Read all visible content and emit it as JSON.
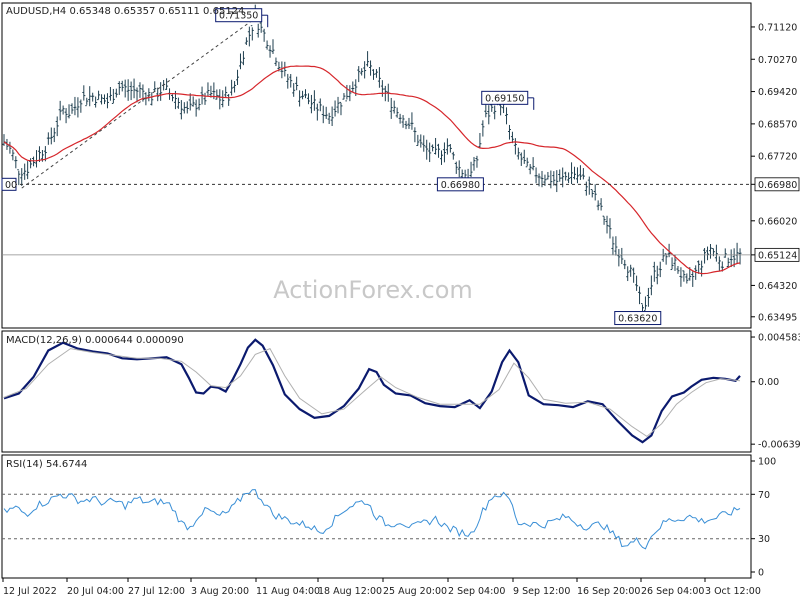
{
  "watermark": "ActionForex.com",
  "colors": {
    "bar": "#1f3f4f",
    "ma": "#d6262b",
    "macd": "#0b1a6e",
    "signal": "#b0b0b0",
    "rsi": "#3a8fd6",
    "frame": "#000000",
    "grid": "#555555"
  },
  "chart_data": [
    {
      "type": "ohlc",
      "panel": "price",
      "title": "AUDUSD,H4  0.65348 0.65357 0.65111 0.65124",
      "ylim": [
        0.632,
        0.7175
      ],
      "y_ticks": [
        "0.71120",
        "0.70270",
        "0.69420",
        "0.68570",
        "0.67720",
        "0.66980",
        "0.66020",
        "0.65124",
        "0.64320",
        "0.63495"
      ],
      "x_ticks": [
        "12 Jul 2022",
        "20 Jul 04:00",
        "27 Jul 12:00",
        "3 Aug 20:00",
        "11 Aug 04:00",
        "18 Aug 12:00",
        "25 Aug 20:00",
        "2 Sep 04:00",
        "9 Sep 12:00",
        "16 Sep 20:00",
        "26 Sep 04:00",
        "3 Oct 12:00"
      ],
      "current_price": "0.65124",
      "horizontal_line": 0.6698,
      "horizontal_line_label": "0.66980",
      "left_edge_label": "00",
      "annotations": [
        {
          "label": "0.71350",
          "value": 0.7135
        },
        {
          "label": "0.69150",
          "value": 0.6915
        },
        {
          "label": "0.66980",
          "value": 0.6698
        },
        {
          "label": "0.63620",
          "value": 0.6362
        }
      ],
      "price_path": [
        [
          0,
          0.681
        ],
        [
          5,
          0.6785
        ],
        [
          10,
          0.6735
        ],
        [
          15,
          0.6735
        ],
        [
          20,
          0.676
        ],
        [
          30,
          0.6805
        ],
        [
          40,
          0.6895
        ],
        [
          45,
          0.6885
        ],
        [
          52,
          0.6925
        ],
        [
          60,
          0.693
        ],
        [
          70,
          0.6915
        ],
        [
          78,
          0.6955
        ],
        [
          85,
          0.6945
        ],
        [
          93,
          0.6945
        ],
        [
          100,
          0.693
        ],
        [
          108,
          0.695
        ],
        [
          116,
          0.6925
        ],
        [
          124,
          0.689
        ],
        [
          132,
          0.6915
        ],
        [
          140,
          0.6935
        ],
        [
          148,
          0.692
        ],
        [
          155,
          0.6945
        ],
        [
          163,
          0.706
        ],
        [
          170,
          0.7135
        ],
        [
          175,
          0.71
        ],
        [
          182,
          0.705
        ],
        [
          190,
          0.6985
        ],
        [
          200,
          0.694
        ],
        [
          210,
          0.6905
        ],
        [
          220,
          0.688
        ],
        [
          230,
          0.6925
        ],
        [
          240,
          0.698
        ],
        [
          247,
          0.701
        ],
        [
          255,
          0.696
        ],
        [
          265,
          0.6895
        ],
        [
          275,
          0.6855
        ],
        [
          283,
          0.6795
        ],
        [
          292,
          0.6775
        ],
        [
          300,
          0.68
        ],
        [
          308,
          0.674
        ],
        [
          315,
          0.6715
        ],
        [
          320,
          0.6765
        ],
        [
          325,
          0.687
        ],
        [
          332,
          0.6905
        ],
        [
          337,
          0.6915
        ],
        [
          345,
          0.6795
        ],
        [
          355,
          0.6735
        ],
        [
          365,
          0.672
        ],
        [
          375,
          0.6705
        ],
        [
          385,
          0.673
        ],
        [
          395,
          0.67
        ],
        [
          405,
          0.662
        ],
        [
          413,
          0.654
        ],
        [
          420,
          0.65
        ],
        [
          428,
          0.643
        ],
        [
          432,
          0.6362
        ],
        [
          440,
          0.646
        ],
        [
          448,
          0.651
        ],
        [
          455,
          0.6485
        ],
        [
          462,
          0.643
        ],
        [
          470,
          0.648
        ],
        [
          478,
          0.653
        ],
        [
          486,
          0.6495
        ],
        [
          492,
          0.651
        ],
        [
          498,
          0.6512
        ]
      ]
    },
    {
      "type": "line",
      "panel": "macd",
      "title": "MACD(12,26,9) 0.000644 0.000090",
      "ylim": [
        -0.0072,
        0.0052
      ],
      "y_ticks": [
        "0.004583",
        "0.00",
        "-0.006397"
      ],
      "series": [
        {
          "name": "macd",
          "points": [
            [
              0,
              -0.0017
            ],
            [
              10,
              -0.0012
            ],
            [
              20,
              0.0005
            ],
            [
              30,
              0.0032
            ],
            [
              40,
              0.004
            ],
            [
              50,
              0.0034
            ],
            [
              60,
              0.0031
            ],
            [
              70,
              0.0029
            ],
            [
              80,
              0.0024
            ],
            [
              90,
              0.0023
            ],
            [
              100,
              0.0024
            ],
            [
              110,
              0.0025
            ],
            [
              120,
              0.0018
            ],
            [
              125,
              0.0004
            ],
            [
              130,
              -0.0011
            ],
            [
              135,
              -0.0012
            ],
            [
              140,
              -0.0005
            ],
            [
              145,
              -0.0006
            ],
            [
              150,
              -0.001
            ],
            [
              155,
              0.0003
            ],
            [
              160,
              0.0018
            ],
            [
              165,
              0.0035
            ],
            [
              170,
              0.0043
            ],
            [
              175,
              0.0037
            ],
            [
              182,
              0.0017
            ],
            [
              190,
              -0.0013
            ],
            [
              200,
              -0.0028
            ],
            [
              210,
              -0.0037
            ],
            [
              220,
              -0.0035
            ],
            [
              230,
              -0.0025
            ],
            [
              240,
              -0.0007
            ],
            [
              247,
              0.0013
            ],
            [
              252,
              0.001
            ],
            [
              257,
              -0.0003
            ],
            [
              265,
              -0.0012
            ],
            [
              275,
              -0.0014
            ],
            [
              285,
              -0.0022
            ],
            [
              295,
              -0.0025
            ],
            [
              305,
              -0.0026
            ],
            [
              315,
              -0.0019
            ],
            [
              322,
              -0.0027
            ],
            [
              330,
              -0.001
            ],
            [
              337,
              0.002
            ],
            [
              342,
              0.0032
            ],
            [
              348,
              0.002
            ],
            [
              355,
              -0.0014
            ],
            [
              365,
              -0.0023
            ],
            [
              375,
              -0.0024
            ],
            [
              385,
              -0.0026
            ],
            [
              395,
              -0.002
            ],
            [
              405,
              -0.0023
            ],
            [
              415,
              -0.004
            ],
            [
              425,
              -0.0055
            ],
            [
              432,
              -0.0062
            ],
            [
              438,
              -0.0055
            ],
            [
              445,
              -0.003
            ],
            [
              452,
              -0.0015
            ],
            [
              460,
              -0.0011
            ],
            [
              465,
              -0.0005
            ],
            [
              472,
              0.0002
            ],
            [
              480,
              0.0004
            ],
            [
              488,
              0.0003
            ],
            [
              495,
              0.0001
            ],
            [
              498,
              0.0006
            ]
          ]
        },
        {
          "name": "signal",
          "points": [
            [
              0,
              -0.0016
            ],
            [
              15,
              -0.0007
            ],
            [
              30,
              0.0018
            ],
            [
              45,
              0.0034
            ],
            [
              60,
              0.003
            ],
            [
              75,
              0.0027
            ],
            [
              90,
              0.0024
            ],
            [
              105,
              0.0024
            ],
            [
              120,
              0.0021
            ],
            [
              130,
              0.001
            ],
            [
              140,
              -0.0004
            ],
            [
              150,
              -0.0006
            ],
            [
              160,
              0.0006
            ],
            [
              170,
              0.0028
            ],
            [
              180,
              0.0034
            ],
            [
              190,
              0.0006
            ],
            [
              200,
              -0.0017
            ],
            [
              215,
              -0.0033
            ],
            [
              230,
              -0.0028
            ],
            [
              245,
              -0.0008
            ],
            [
              255,
              0.0005
            ],
            [
              265,
              -0.0006
            ],
            [
              280,
              -0.0016
            ],
            [
              295,
              -0.0023
            ],
            [
              310,
              -0.0023
            ],
            [
              322,
              -0.0023
            ],
            [
              335,
              -0.0008
            ],
            [
              345,
              0.0019
            ],
            [
              355,
              0.0004
            ],
            [
              365,
              -0.0018
            ],
            [
              380,
              -0.0022
            ],
            [
              395,
              -0.0021
            ],
            [
              410,
              -0.0028
            ],
            [
              425,
              -0.0046
            ],
            [
              435,
              -0.0056
            ],
            [
              445,
              -0.0043
            ],
            [
              455,
              -0.0023
            ],
            [
              465,
              -0.0011
            ],
            [
              475,
              -0.0001
            ],
            [
              485,
              0.0003
            ],
            [
              498,
              0.0001
            ]
          ]
        }
      ]
    },
    {
      "type": "line",
      "panel": "rsi",
      "title": "RSI(14) 54.6744",
      "ylim": [
        0,
        100
      ],
      "y_ticks": [
        "100",
        "70",
        "30",
        "0"
      ],
      "levels": [
        70,
        30
      ],
      "series": [
        {
          "name": "rsi",
          "points": [
            [
              0,
              54
            ],
            [
              8,
              58
            ],
            [
              15,
              52
            ],
            [
              22,
              60
            ],
            [
              30,
              64
            ],
            [
              38,
              70
            ],
            [
              45,
              68
            ],
            [
              52,
              64
            ],
            [
              60,
              66
            ],
            [
              68,
              62
            ],
            [
              75,
              64
            ],
            [
              82,
              60
            ],
            [
              90,
              66
            ],
            [
              98,
              62
            ],
            [
              105,
              64
            ],
            [
              113,
              60
            ],
            [
              120,
              44
            ],
            [
              126,
              40
            ],
            [
              132,
              52
            ],
            [
              138,
              56
            ],
            [
              145,
              50
            ],
            [
              152,
              54
            ],
            [
              160,
              66
            ],
            [
              165,
              74
            ],
            [
              170,
              72
            ],
            [
              175,
              65
            ],
            [
              182,
              52
            ],
            [
              190,
              48
            ],
            [
              198,
              44
            ],
            [
              206,
              42
            ],
            [
              214,
              36
            ],
            [
              222,
              45
            ],
            [
              230,
              56
            ],
            [
              238,
              62
            ],
            [
              245,
              64
            ],
            [
              252,
              50
            ],
            [
              260,
              42
            ],
            [
              268,
              46
            ],
            [
              276,
              40
            ],
            [
              284,
              44
            ],
            [
              292,
              48
            ],
            [
              300,
              40
            ],
            [
              308,
              36
            ],
            [
              316,
              34
            ],
            [
              324,
              55
            ],
            [
              330,
              68
            ],
            [
              336,
              70
            ],
            [
              342,
              66
            ],
            [
              348,
              44
            ],
            [
              356,
              44
            ],
            [
              364,
              42
            ],
            [
              372,
              46
            ],
            [
              380,
              50
            ],
            [
              388,
              44
            ],
            [
              396,
              40
            ],
            [
              404,
              44
            ],
            [
              412,
              34
            ],
            [
              420,
              24
            ],
            [
              428,
              28
            ],
            [
              434,
              24
            ],
            [
              440,
              36
            ],
            [
              448,
              46
            ],
            [
              456,
              48
            ],
            [
              464,
              50
            ],
            [
              472,
              46
            ],
            [
              480,
              48
            ],
            [
              488,
              52
            ],
            [
              495,
              55
            ],
            [
              498,
              58
            ]
          ]
        }
      ]
    }
  ]
}
